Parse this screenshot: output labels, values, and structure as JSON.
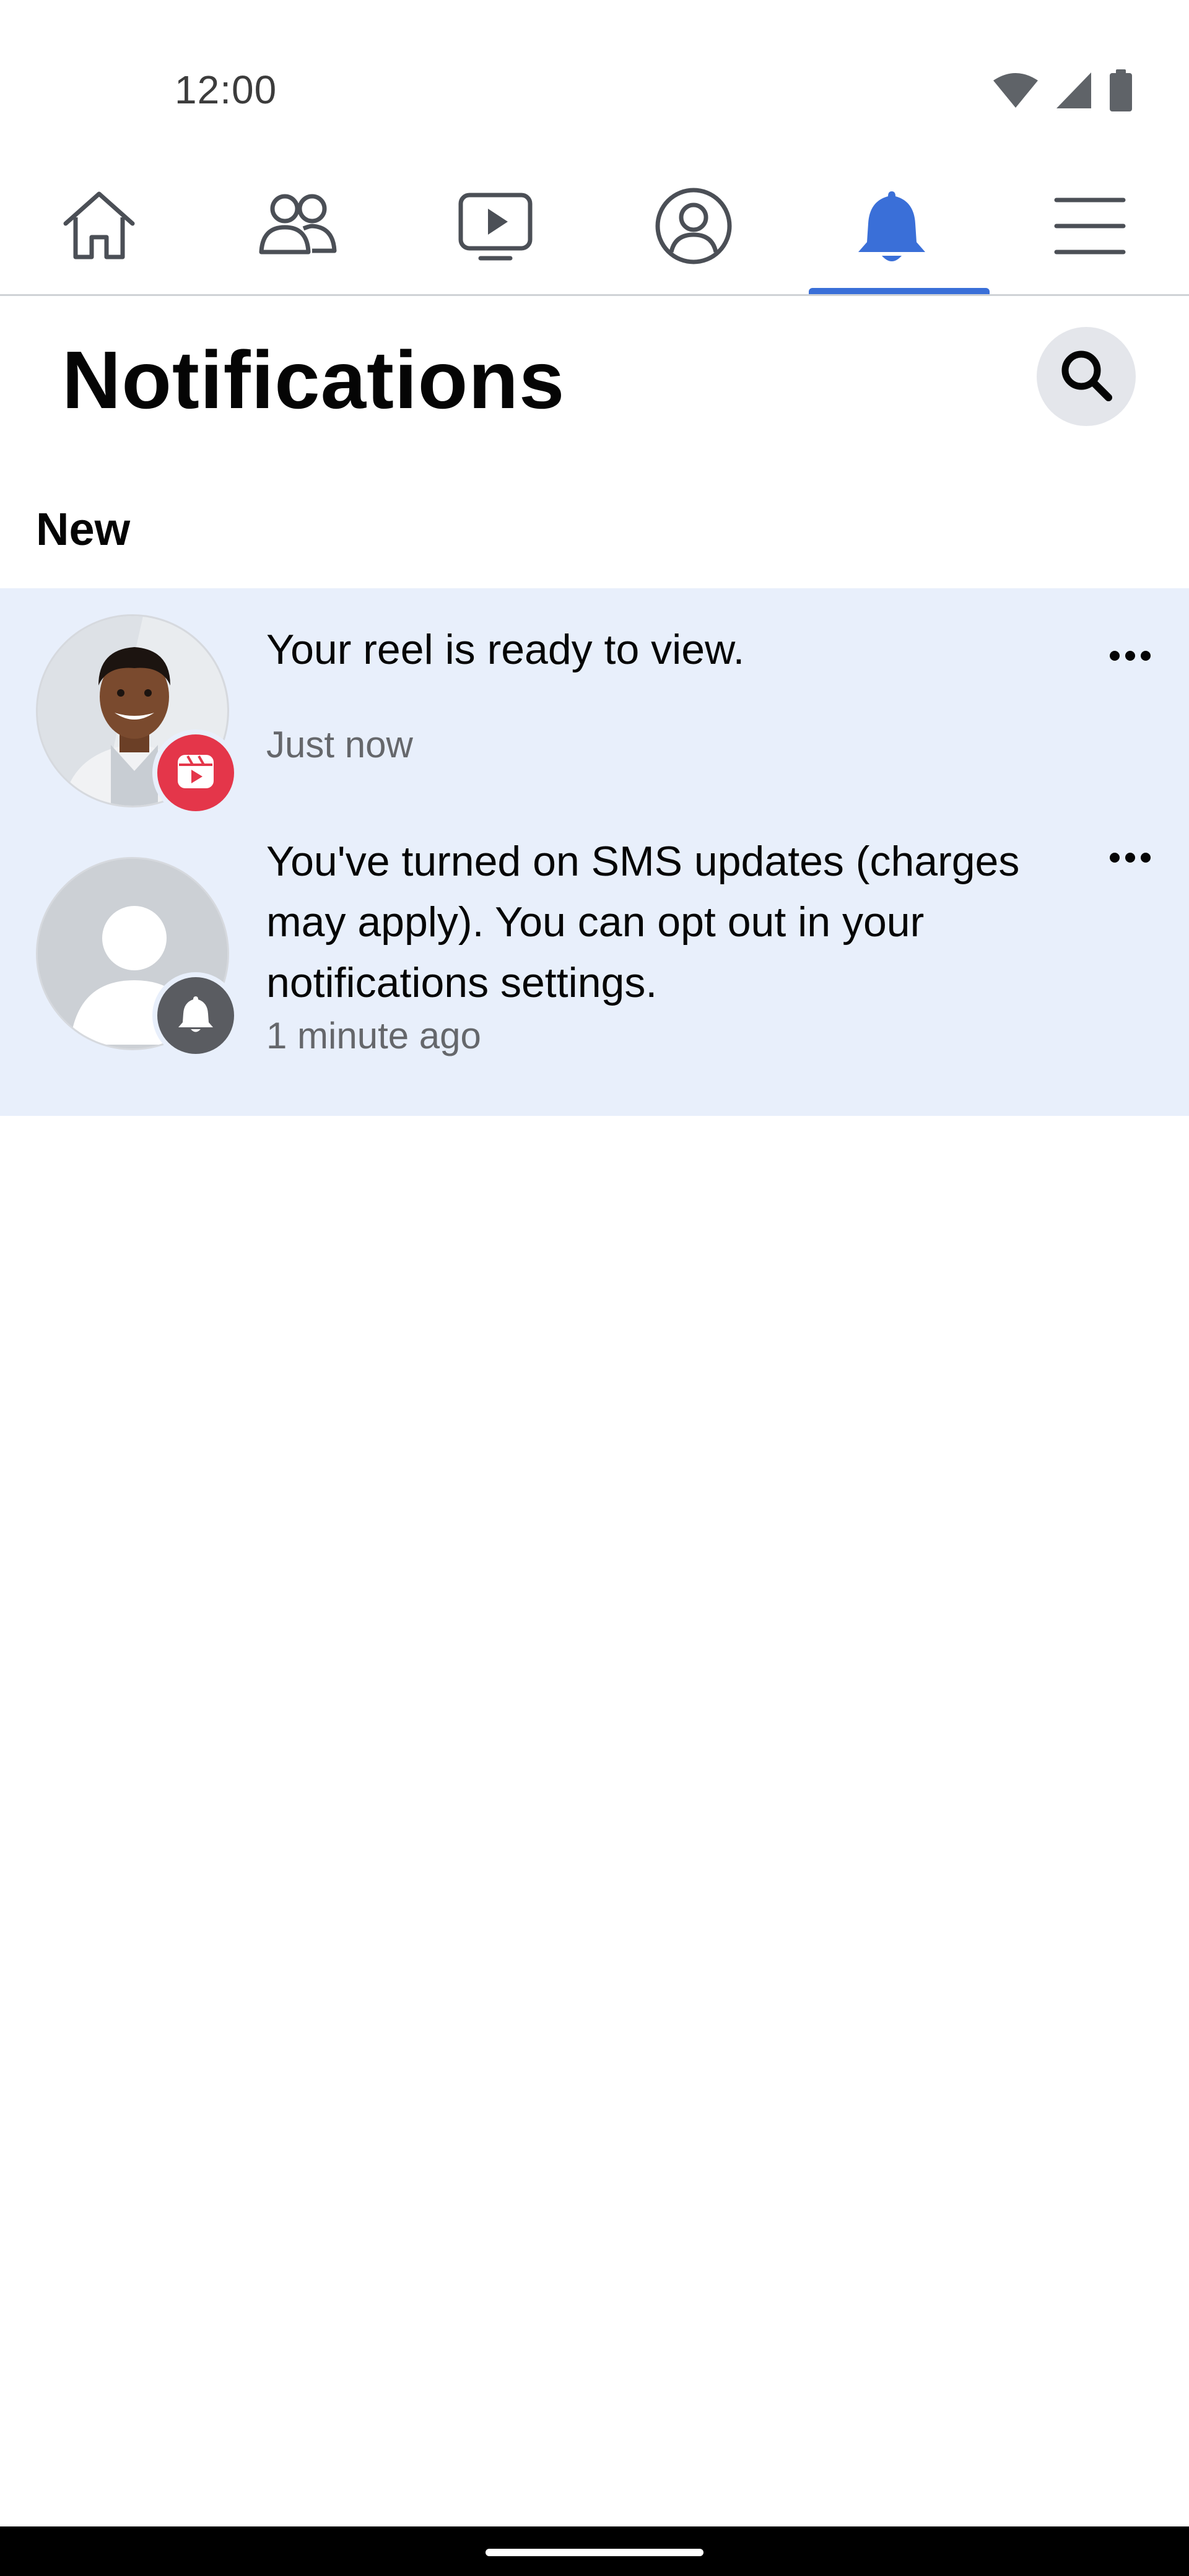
{
  "status_bar": {
    "time": "12:00",
    "icons": [
      "wifi-icon",
      "cellular-signal-icon",
      "battery-icon"
    ]
  },
  "tabs": [
    {
      "name": "home",
      "icon": "home-icon",
      "active": false
    },
    {
      "name": "friends",
      "icon": "friends-icon",
      "active": false
    },
    {
      "name": "video",
      "icon": "video-icon",
      "active": false
    },
    {
      "name": "profile",
      "icon": "profile-icon",
      "active": false
    },
    {
      "name": "notifications",
      "icon": "bell-icon",
      "active": true
    },
    {
      "name": "menu",
      "icon": "menu-icon",
      "active": false
    }
  ],
  "header": {
    "title": "Notifications",
    "search_icon": "search-icon"
  },
  "section": {
    "label": "New"
  },
  "notifications": [
    {
      "text": "Your reel is ready to view.",
      "time": "Just now",
      "avatar": "user-photo",
      "badge_icon": "reel-icon",
      "unread": true
    },
    {
      "text": "You've turned on SMS updates (charges may apply). You can opt out in your notifications settings.",
      "time": "1 minute ago",
      "avatar": "default-avatar",
      "badge_icon": "bell-icon",
      "unread": true
    }
  ],
  "colors": {
    "accent": "#3a6fd8",
    "unread_background": "#e8effb",
    "reel_badge": "#e4364a",
    "bell_badge": "#5a5c61",
    "secondary_text": "#65676b"
  }
}
